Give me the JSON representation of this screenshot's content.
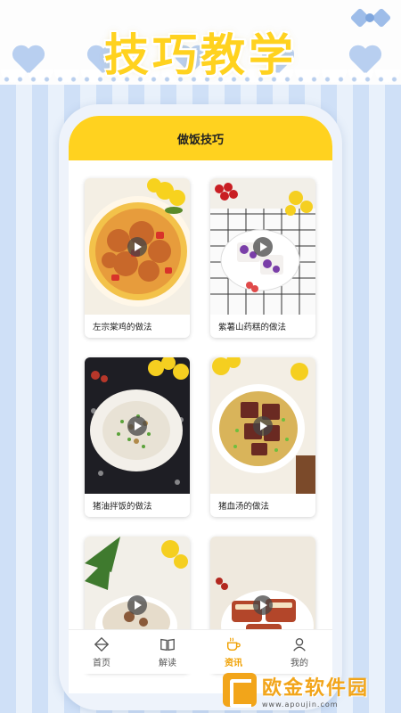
{
  "banner": {
    "title": "技巧教学"
  },
  "app": {
    "header_title": "做饭技巧"
  },
  "cards": [
    {
      "label": "左宗棠鸡的做法",
      "thumb": "orange-chicken-dish"
    },
    {
      "label": "紫薯山药糕的做法",
      "thumb": "purple-yam-cake"
    },
    {
      "label": "猪油拌饭的做法",
      "thumb": "lard-rice-bowl"
    },
    {
      "label": "猪血汤的做法",
      "thumb": "pig-blood-soup"
    },
    {
      "label": "",
      "thumb": "soup-bowl"
    },
    {
      "label": "",
      "thumb": "braised-meat"
    }
  ],
  "tabbar": {
    "items": [
      {
        "label": "首页",
        "icon": "home-icon",
        "active": false
      },
      {
        "label": "解读",
        "icon": "book-icon",
        "active": false
      },
      {
        "label": "资讯",
        "icon": "coffee-icon",
        "active": true
      },
      {
        "label": "我的",
        "icon": "user-icon",
        "active": false
      }
    ]
  },
  "watermark": {
    "text": "欧金软件园",
    "url": "www.apoujin.com"
  },
  "colors": {
    "accent": "#ffd21f",
    "active_tab": "#f0a000",
    "watermark": "#f2a51a"
  }
}
